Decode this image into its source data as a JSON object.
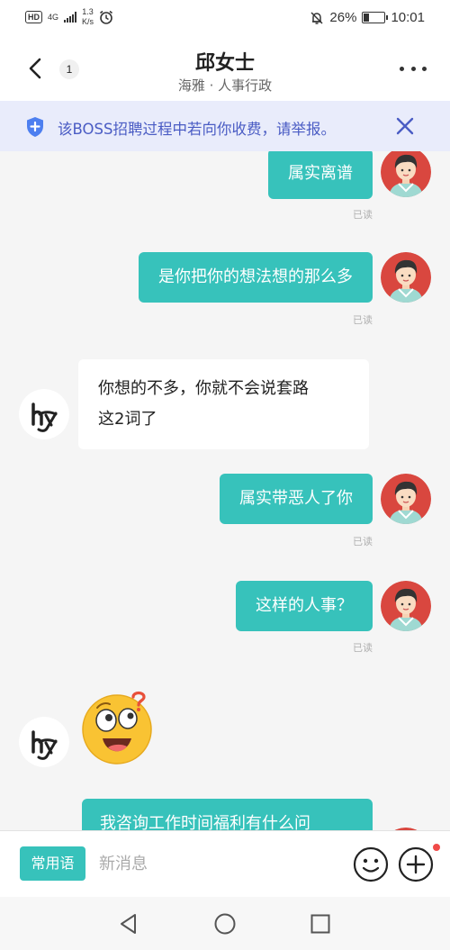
{
  "status_bar": {
    "hd": "HD",
    "network": "4G",
    "speed_value": "1.3",
    "speed_unit": "K/s",
    "battery_percent": "26%",
    "battery_level": 0.26,
    "time": "10:01"
  },
  "header": {
    "unread_count": "1",
    "contact_name": "邱女士",
    "contact_detail": "海雅 · 人事行政"
  },
  "notice": {
    "text": "该BOSS招聘过程中若向你收费，请举报。"
  },
  "messages": [
    {
      "from": "me",
      "text": "属实离谱",
      "status": "已读"
    },
    {
      "from": "me",
      "text": "是你把你的想法想的那么多",
      "status": "已读"
    },
    {
      "from": "other",
      "lines": [
        "你想的不多，你就不会说套路",
        "这2词了"
      ]
    },
    {
      "from": "me",
      "text": "属实带恶人了你",
      "status": "已读"
    },
    {
      "from": "me",
      "text": "这样的人事？",
      "status": "已读"
    },
    {
      "from": "other",
      "sticker": "confused-face-emoji"
    },
    {
      "from": "me",
      "text": "我咨询工作时间福利有什么问"
    }
  ],
  "input_bar": {
    "phrases_label": "常用语",
    "placeholder": "新消息"
  },
  "colors": {
    "accent": "#37c2bb",
    "notice_bg": "#e9ecfb",
    "notice_text": "#4a5cc4",
    "chat_bg": "#f5f5f5",
    "badge_red": "#f04a48"
  },
  "icons": [
    "back-arrow-icon",
    "more-dots-icon",
    "shield-plus-icon",
    "close-x-icon",
    "emoji-icon",
    "plus-icon",
    "nav-back-icon",
    "nav-home-icon",
    "nav-recents-icon"
  ]
}
